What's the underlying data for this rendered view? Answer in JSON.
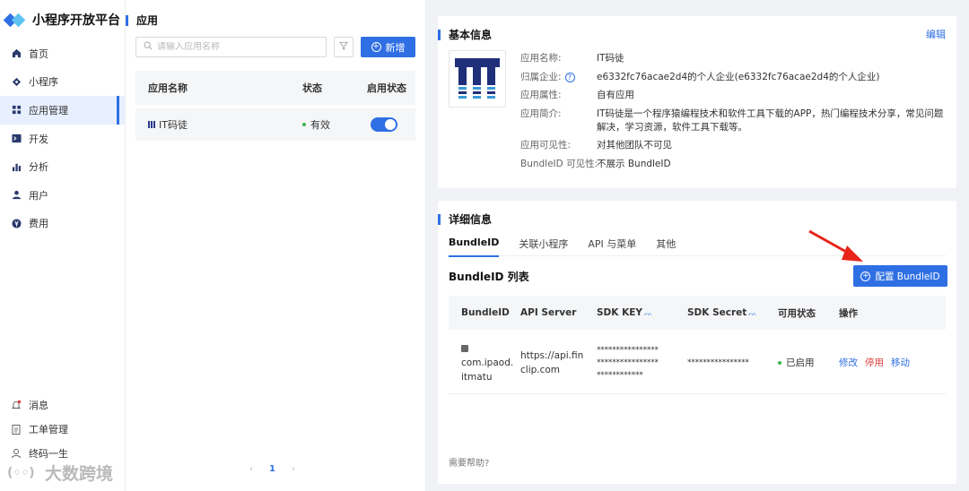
{
  "sidebar": {
    "logo_text": "小程序开放平台",
    "items": [
      {
        "label": "首页",
        "icon": "home-icon"
      },
      {
        "label": "小程序",
        "icon": "diamond-icon"
      },
      {
        "label": "应用管理",
        "icon": "grid-icon"
      },
      {
        "label": "开发",
        "icon": "terminal-icon"
      },
      {
        "label": "分析",
        "icon": "bar-chart-icon"
      },
      {
        "label": "用户",
        "icon": "user-icon"
      },
      {
        "label": "费用",
        "icon": "yen-icon"
      }
    ],
    "active_index": 2,
    "bottom_items": [
      {
        "label": "消息",
        "icon": "bell-icon"
      },
      {
        "label": "工单管理",
        "icon": "clipboard-icon"
      },
      {
        "label": "终码一生",
        "icon": "person-icon"
      }
    ],
    "watermark": "大数跨境"
  },
  "app_list": {
    "title": "应用",
    "search_placeholder": "请输入应用名称",
    "add_label": "新增",
    "columns": [
      "应用名称",
      "状态",
      "启用状态"
    ],
    "rows": [
      {
        "name": "IT码徒",
        "status": "有效",
        "enabled": true
      }
    ],
    "pagination": {
      "prev": "‹",
      "current": "1",
      "next": "›"
    }
  },
  "basic_info": {
    "title": "基本信息",
    "edit_label": "编辑",
    "fields": [
      {
        "label": "应用名称:",
        "value": "IT码徒"
      },
      {
        "label": "归属企业:",
        "value": "e6332fc76acae2d4的个人企业(e6332fc76acae2d4的个人企业)"
      },
      {
        "label": "应用属性:",
        "value": "自有应用"
      },
      {
        "label": "应用简介:",
        "value": "IT码徒是一个程序猿编程技术和软件工具下载的APP，热门编程技术分享，常见问题解决，学习资源，软件工具下载等。"
      },
      {
        "label": "应用可见性:",
        "value": "对其他团队不可见"
      },
      {
        "label": "BundleID 可见性:",
        "value": "不展示 BundleID"
      }
    ]
  },
  "detail_info": {
    "title": "详细信息",
    "tabs": [
      "BundleID",
      "关联小程序",
      "API 与菜单",
      "其他"
    ],
    "active_tab": 0,
    "list_title": "BundleID 列表",
    "config_label": "配置 BundleID",
    "columns": [
      "BundleID",
      "API Server",
      "SDK KEY",
      "SDK Secret",
      "可用状态",
      "操作"
    ],
    "rows": [
      {
        "bundle_id_line1": "com.ipaod.",
        "bundle_id_line2": "itmatu",
        "api_server_line1": "https://api.fin",
        "api_server_line2": "clip.com",
        "sdk_key_line1": "****************",
        "sdk_key_line2": "****************",
        "sdk_key_line3": "************",
        "sdk_secret": "****************",
        "status": "已启用",
        "actions": {
          "modify": "修改",
          "disable": "停用",
          "move": "移动"
        }
      }
    ],
    "help": "需要帮助?"
  },
  "colors": {
    "primary": "#2f6fe4",
    "danger": "#e04040",
    "success": "#3bb54a",
    "arrow": "#e8231a"
  }
}
